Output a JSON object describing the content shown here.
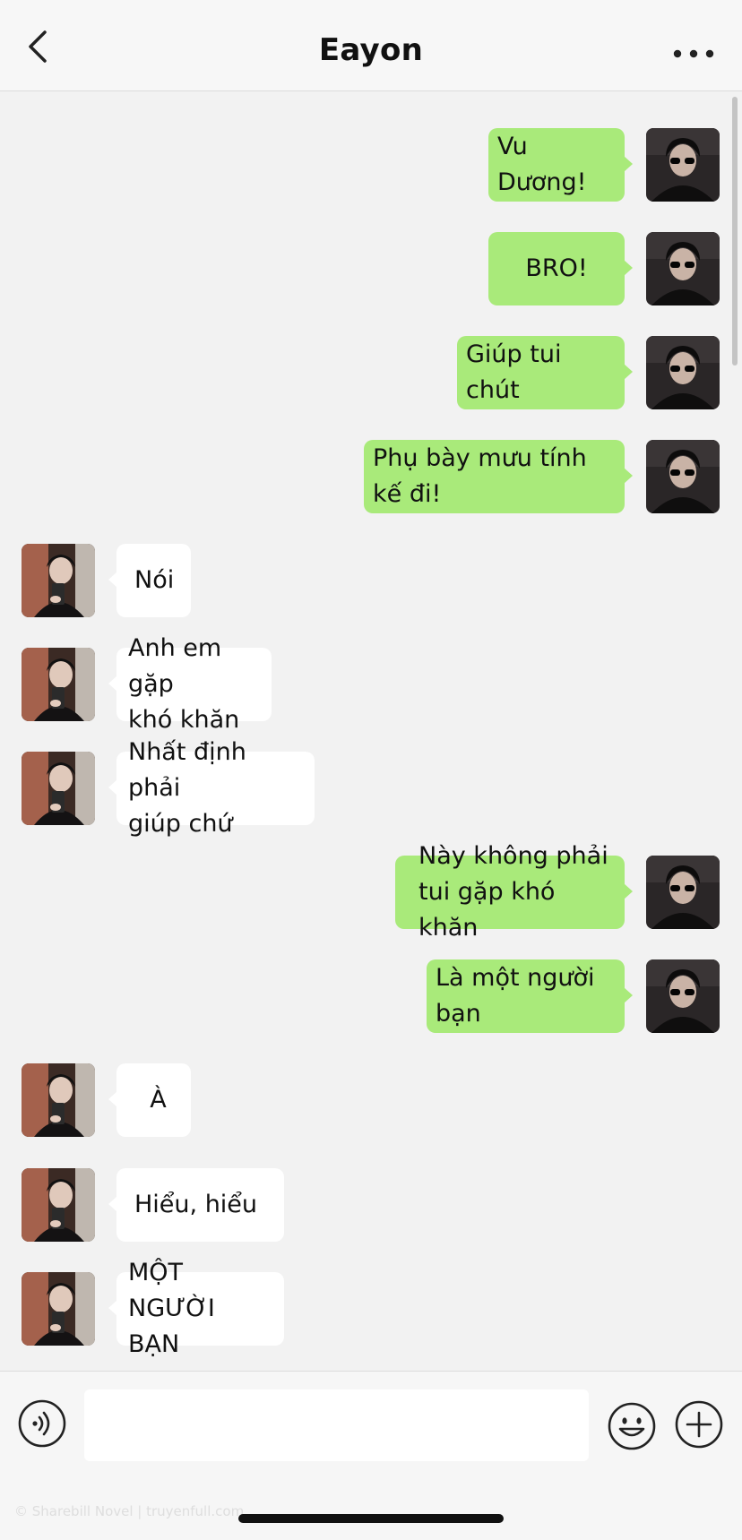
{
  "header": {
    "title": "Eayon",
    "back_icon": "chevron-left-icon",
    "more_icon": "more-dots-icon"
  },
  "colors": {
    "outgoing_bubble": "#a9ea7a",
    "incoming_bubble": "#ffffff",
    "chat_background": "#f2f2f2"
  },
  "messages": [
    {
      "dir": "out",
      "lines": [
        "Vu Dương!"
      ]
    },
    {
      "dir": "out",
      "lines": [
        "BRO!"
      ]
    },
    {
      "dir": "out",
      "lines": [
        "Giúp tui chút"
      ]
    },
    {
      "dir": "out",
      "lines": [
        "Phụ bày mưu tính kế đi!"
      ]
    },
    {
      "dir": "in",
      "lines": [
        "Nói"
      ]
    },
    {
      "dir": "in",
      "lines": [
        "Anh em gặp",
        "khó khăn"
      ]
    },
    {
      "dir": "in",
      "lines": [
        "Nhất định phải",
        "giúp chứ"
      ]
    },
    {
      "dir": "out",
      "lines": [
        "Này không phải",
        "tui gặp khó khăn"
      ]
    },
    {
      "dir": "out",
      "lines": [
        "Là một người bạn"
      ]
    },
    {
      "dir": "in",
      "lines": [
        "À"
      ]
    },
    {
      "dir": "in",
      "lines": [
        "Hiểu, hiểu"
      ]
    },
    {
      "dir": "in",
      "lines": [
        "MỘT NGƯỜI",
        "BẠN"
      ]
    }
  ],
  "input_bar": {
    "voice_icon": "voice-icon",
    "input_value": "",
    "emoji_icon": "emoji-icon",
    "plus_icon": "plus-icon",
    "watermark": "© Sharebill Novel | truyenfull.com"
  }
}
